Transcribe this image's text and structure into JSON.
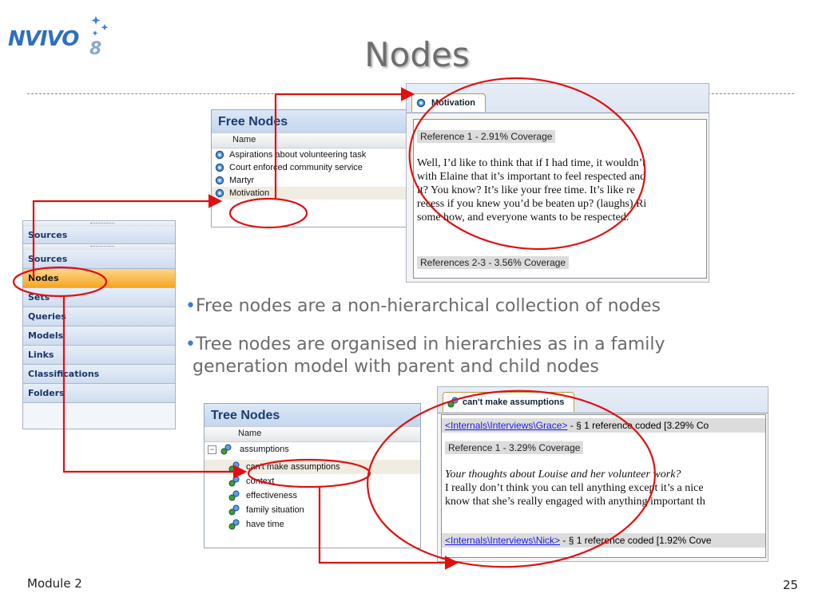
{
  "logo": {
    "word": "NVIVO",
    "version": "8"
  },
  "title": "Nodes",
  "free_nodes": {
    "header": "Free Nodes",
    "column": "Name",
    "rows": [
      "Aspirations about volunteering task",
      "Court enforced community service",
      "Martyr",
      "Motivation"
    ]
  },
  "motivation_doc": {
    "tab": "Motivation",
    "ref1": "Reference 1 - 2.91% Coverage",
    "lines": [
      "Well, I’d like to think that if I had time, it wouldn’t",
      "with Elaine that it’s important to feel respected and",
      "it?  You know?  It’s like your free time.  It’s like re",
      "recess if you knew you’d be beaten up? (laughs) Ri",
      "some how, and everyone wants to be respected."
    ],
    "ref2": "References 2-3 - 3.56% Coverage"
  },
  "navigator": {
    "top": "Sources",
    "items": [
      "Sources",
      "Nodes",
      "Sets",
      "Queries",
      "Models",
      "Links",
      "Classifications",
      "Folders"
    ],
    "active": "Nodes"
  },
  "bullets": {
    "b1": "Free nodes are a non-hierarchical collection of nodes",
    "b2_line1": "Tree nodes are organised in hierarchies as in a family",
    "b2_line2": "generation model with parent and child nodes"
  },
  "tree_nodes": {
    "header": "Tree Nodes",
    "column": "Name",
    "parent": "assumptions",
    "children": [
      "can't make assumptions",
      "context",
      "effectiveness",
      "family situation",
      "have time"
    ]
  },
  "assumptions_doc": {
    "tab": "can't make assumptions",
    "link1": "<Internals\\Interviews\\Grace>",
    "link1_rest": " - § 1 reference coded  [3.29% Co",
    "ref1": "Reference 1 - 3.29% Coverage",
    "question": "Your thoughts about Louise and her volunteer work?",
    "lines": [
      "I really don’t think you can tell anything except it’s a nice",
      "know that she’s really engaged with anything important th"
    ],
    "link2": "<Internals\\Interviews\\Nick>",
    "link2_rest": " - § 1 reference coded  [1.92% Cove"
  },
  "footer": {
    "module": "Module 2",
    "page": "25"
  },
  "colors": {
    "accent": "#3b7fcf",
    "highlight": "#e01010",
    "nav_active": "#f5a623"
  }
}
